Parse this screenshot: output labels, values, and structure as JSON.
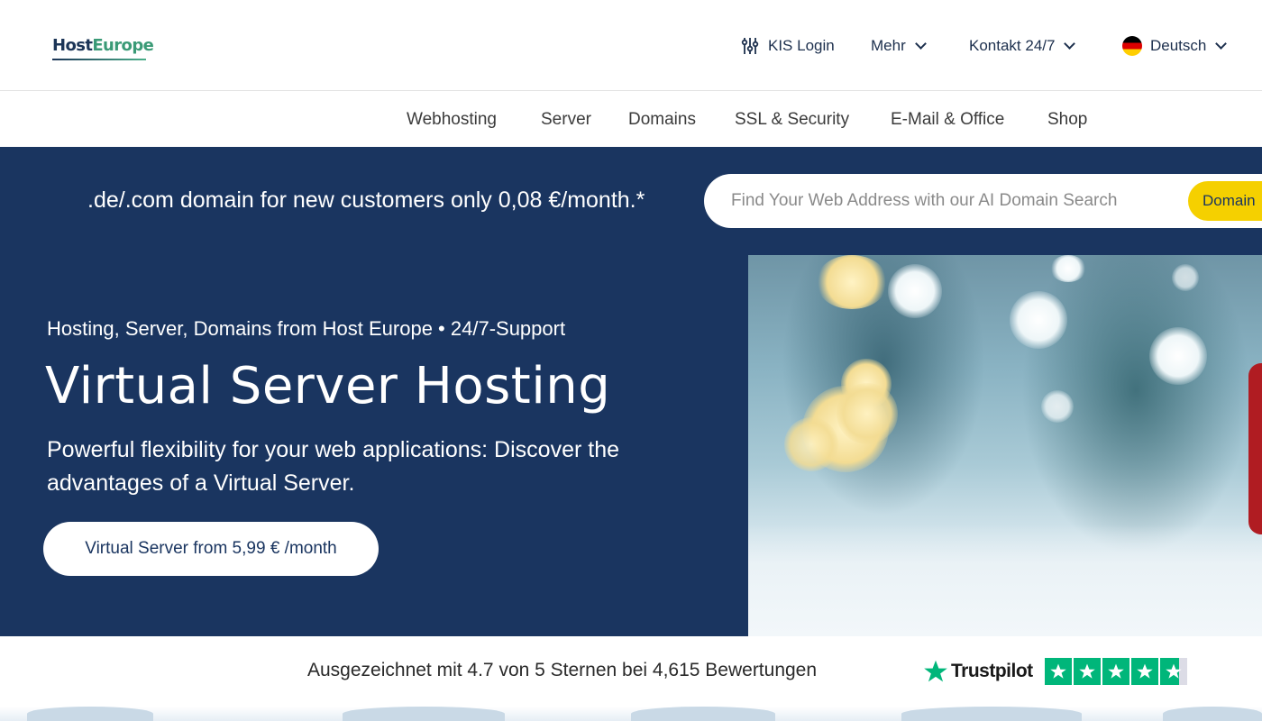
{
  "header": {
    "logo": {
      "part1": "Host",
      "part2": "Europe"
    },
    "kis_login": "KIS Login",
    "more": "Mehr",
    "contact": "Kontakt 24/7",
    "language": "Deutsch"
  },
  "nav": {
    "items": [
      {
        "label": "Webhosting"
      },
      {
        "label": "Server"
      },
      {
        "label": "Domains"
      },
      {
        "label": "SSL & Security"
      },
      {
        "label": "E-Mail & Office"
      },
      {
        "label": "Shop"
      }
    ]
  },
  "promo": {
    "text": ".de/.com domain for new customers only 0,08 €/month.*",
    "search_placeholder": "Find Your Web Address with our AI Domain Search",
    "search_button": "Domain"
  },
  "hero": {
    "subtitle": "Hosting, Server, Domains from Host Europe • 24/7-Support",
    "title": "Virtual Server Hosting",
    "description": "Powerful flexibility for your web applications: Discover the advantages of a Virtual Server.",
    "cta": "Virtual Server from 5,99 € /month"
  },
  "trust": {
    "text": "Ausgezeichnet mit 4.7 von 5 Sternen bei 4,615 Bewertungen",
    "brand": "Trustpilot",
    "rating": 4.7,
    "max_rating": 5
  },
  "colors": {
    "navy": "#1a3560",
    "yellow": "#f5d000",
    "trustpilot_green": "#00b67a"
  }
}
